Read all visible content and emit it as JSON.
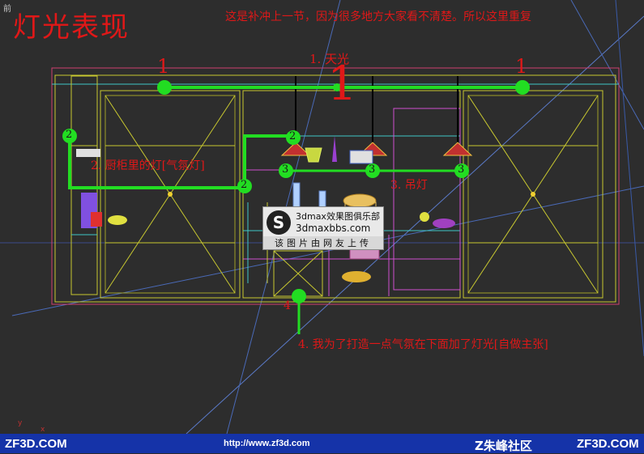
{
  "viewport": {
    "label": "前",
    "title": "灯光表现",
    "note": "这是补冲上一节，因为很多地方大家看不清楚。所以这里重复"
  },
  "annotations": {
    "sky_light": "1. 天光",
    "cabinet_light": "2. 厨柜里的灯[气氛灯]",
    "pendant_light": "3. 吊灯",
    "under_light": "4. 我为了打造一点气氛在下面加了灯光[自做主张]",
    "marker_1": "1",
    "marker_1_big": "1",
    "marker_2": "2",
    "marker_3": "3",
    "marker_4": "4"
  },
  "watermark": {
    "line1": "3dmax效果图俱乐部",
    "line2": "3dmaxbbs.com",
    "line3": "该图片由网友上传",
    "logo": "S"
  },
  "footer": {
    "left": "ZF3D.COM",
    "url": "http://www.zf3d.com",
    "brand": "Z朱峰社区",
    "right": "ZF3D.COM"
  },
  "axis": {
    "y": "y",
    "x": "x"
  },
  "colors": {
    "background": "#2d2d2d",
    "annotation_red": "#e01818",
    "light_green": "#22dd22",
    "footer_blue": "#1533a8"
  }
}
